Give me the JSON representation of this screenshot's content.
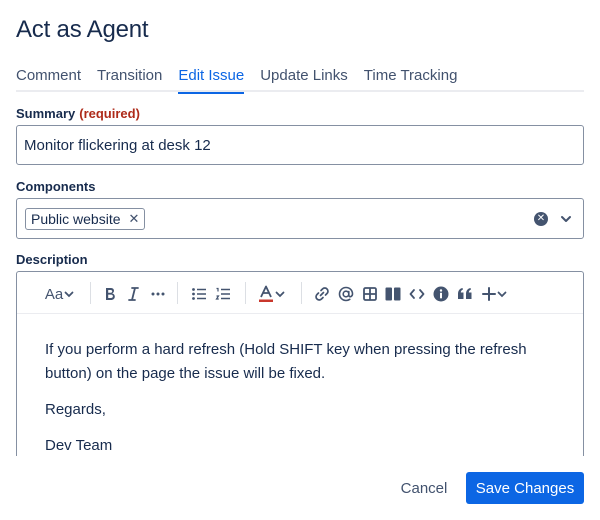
{
  "dialog": {
    "title": "Act as Agent"
  },
  "tabs": [
    {
      "label": "Comment"
    },
    {
      "label": "Transition"
    },
    {
      "label": "Edit Issue",
      "active": true
    },
    {
      "label": "Update Links"
    },
    {
      "label": "Time Tracking"
    }
  ],
  "summary": {
    "label": "Summary",
    "required": "(required)",
    "value": "Monitor flickering at desk 12"
  },
  "components": {
    "label": "Components",
    "selected": [
      "Public website"
    ]
  },
  "description": {
    "label": "Description",
    "toolbar": [
      "text-style",
      "bold",
      "italic",
      "more-formatting",
      "bullet-list",
      "numbered-list",
      "text-color",
      "link",
      "mention",
      "table",
      "layout",
      "code",
      "info-panel",
      "quote",
      "insert"
    ],
    "toolbar_text_style": "Aa",
    "paragraphs": [
      "If you perform a hard refresh (Hold SHIFT key when pressing the refresh button) on the page the issue will be fixed.",
      "Regards,",
      "Dev Team"
    ]
  },
  "footer": {
    "cancel": "Cancel",
    "save": "Save Changes"
  },
  "colors": {
    "primary": "#0C66E4",
    "required": "#AE2A19",
    "text": "#172B4D"
  }
}
